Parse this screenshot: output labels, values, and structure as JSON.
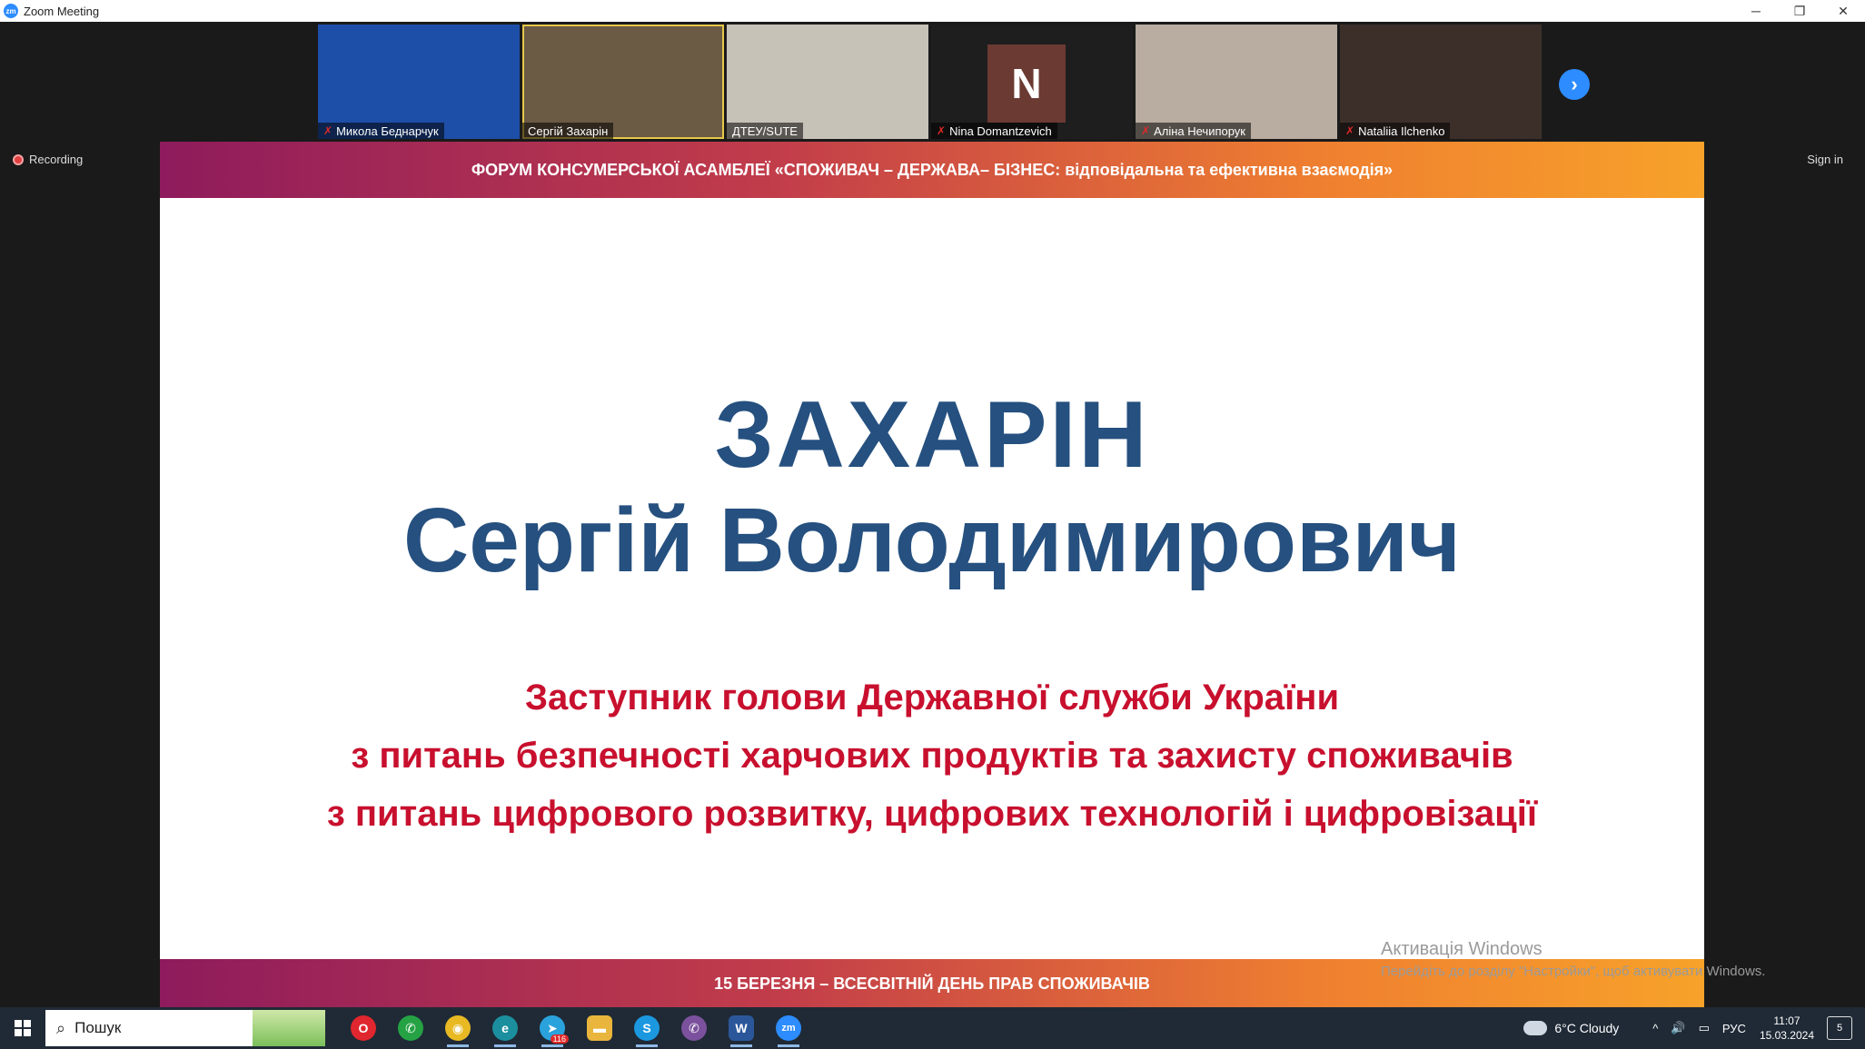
{
  "window": {
    "title": "Zoom Meeting",
    "app_icon": "zm",
    "controls": [
      "─",
      "❐",
      "✕"
    ]
  },
  "participants": [
    {
      "name": "Микола Беднарчук",
      "muted": true,
      "video": true,
      "bg": "#1e4fa8"
    },
    {
      "name": "Сергій Захарін",
      "muted": false,
      "video": true,
      "active": true,
      "bg": "#6b5a44"
    },
    {
      "name": "ДТЕУ/SUTE",
      "muted": false,
      "video": true,
      "bg": "#c7c2b8"
    },
    {
      "name": "Nina Domantzevich",
      "muted": true,
      "video": false,
      "initial": "N",
      "bg": "#1e1e1e"
    },
    {
      "name": "Аліна Нечипорук",
      "muted": true,
      "video": true,
      "bg": "#b9aca0"
    },
    {
      "name": "Nataliia Ilchenko",
      "muted": true,
      "video": true,
      "bg": "#3c2f2a"
    }
  ],
  "next_arrow": "›",
  "recording_label": "Recording",
  "sign_in_label": "Sign in",
  "slide": {
    "header": "ФОРУМ КОНСУМЕРСЬКОЇ АСАМБЛЕЇ «СПОЖИВАЧ – ДЕРЖАВА– БІЗНЕС: відповідальна та ефективна взаємодія»",
    "surname": "ЗАХАРІН",
    "first_patronymic": "Сергій Володимирович",
    "position_lines": [
      "Заступник голови Державної служби України",
      "з питань безпечності харчових продуктів та захисту споживачів",
      "з питань цифрового розвитку, цифрових технологій і цифровізації"
    ],
    "footer": "15 БЕРЕЗНЯ – ВСЕСВІТНІЙ ДЕНЬ ПРАВ СПОЖИВАЧІВ"
  },
  "watermark": {
    "title": "Активація Windows",
    "subtitle": "Перейдіть до розділу \"Настройки\", щоб активувати Windows."
  },
  "taskbar": {
    "search_placeholder": "Пошук",
    "apps": [
      {
        "name": "opera-icon",
        "glyph": "O",
        "color": "#e0262e",
        "open": false
      },
      {
        "name": "whatsapp-icon",
        "glyph": "✆",
        "color": "#25a244",
        "open": false
      },
      {
        "name": "chrome-icon",
        "glyph": "◉",
        "color": "#e8b923",
        "open": true
      },
      {
        "name": "edge-icon",
        "glyph": "e",
        "color": "#1b8f9e",
        "open": true
      },
      {
        "name": "telegram-icon",
        "glyph": "➤",
        "color": "#2aa3dd",
        "open": true,
        "badge": "116"
      },
      {
        "name": "file-explorer-icon",
        "glyph": "▬",
        "color": "#e9b53c",
        "open": false
      },
      {
        "name": "skype-icon",
        "glyph": "S",
        "color": "#1b98e0",
        "open": true
      },
      {
        "name": "viber-icon",
        "glyph": "✆",
        "color": "#7b519d",
        "open": false
      },
      {
        "name": "word-icon",
        "glyph": "W",
        "color": "#2b579a",
        "open": true
      },
      {
        "name": "zoom-icon",
        "glyph": "zm",
        "color": "#2d8cff",
        "open": true
      }
    ],
    "weather": "6°C  Cloudy",
    "language": "РУС",
    "time": "11:07",
    "date": "15.03.2024",
    "notifications": "5"
  }
}
